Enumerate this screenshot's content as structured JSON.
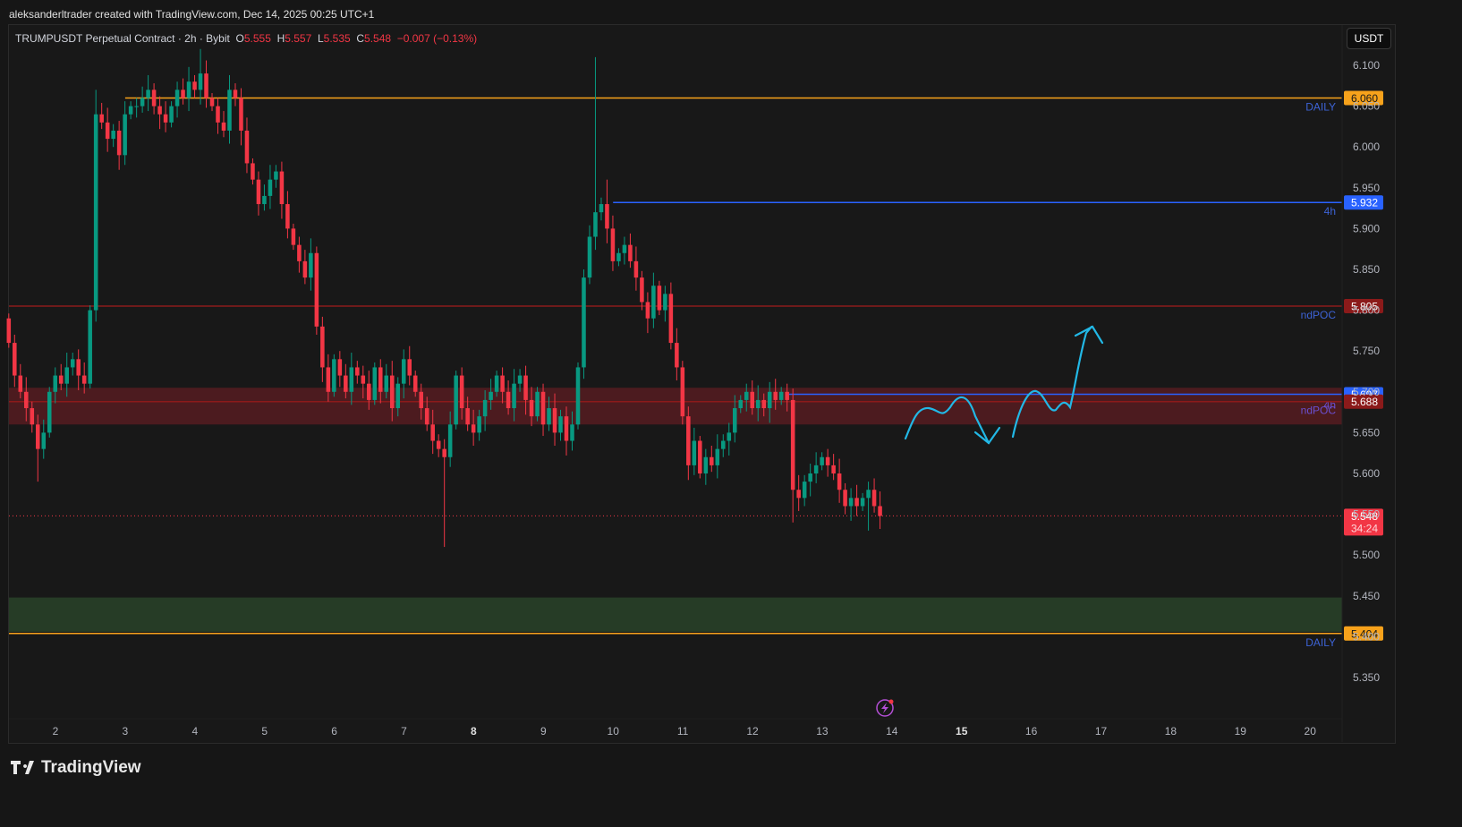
{
  "credit": "aleksanderltrader created with TradingView.com, Dec 14, 2025 00:25 UTC+1",
  "legend": {
    "symbol": "TRUMPUSDT Perpetual Contract · 2h · Bybit",
    "o_label": "O",
    "o": "5.555",
    "h_label": "H",
    "h": "5.557",
    "l_label": "L",
    "l": "5.535",
    "c_label": "C",
    "c": "5.548",
    "change": "−0.007 (−0.13%)"
  },
  "currency_button": "USDT",
  "logo_text": "TradingView",
  "colors": {
    "up": "#089981",
    "down": "#f23645",
    "daily": "#f7a21b",
    "blue": "#2962ff",
    "poc": "#8b1a1a",
    "cyan": "#22b8e6"
  },
  "chart_data": {
    "type": "candlestick",
    "title": "TRUMPUSDT Perpetual Contract · 2h · Bybit",
    "ylim": [
      5.3,
      6.15
    ],
    "y_ticks": [
      "6.100",
      "6.050",
      "6.000",
      "5.950",
      "5.900",
      "5.850",
      "5.800",
      "5.750",
      "5.700",
      "5.650",
      "5.600",
      "5.550",
      "5.500",
      "5.450",
      "5.400",
      "5.350"
    ],
    "y_tick_values": [
      6.1,
      6.05,
      6.0,
      5.95,
      5.9,
      5.85,
      5.8,
      5.75,
      5.7,
      5.65,
      5.6,
      5.55,
      5.5,
      5.45,
      5.4,
      5.35
    ],
    "x_ticks": [
      {
        "label": "2",
        "day": 2
      },
      {
        "label": "3",
        "day": 3
      },
      {
        "label": "4",
        "day": 4
      },
      {
        "label": "5",
        "day": 5
      },
      {
        "label": "6",
        "day": 6
      },
      {
        "label": "7",
        "day": 7
      },
      {
        "label": "8",
        "day": 8,
        "bold": true
      },
      {
        "label": "9",
        "day": 9
      },
      {
        "label": "10",
        "day": 10
      },
      {
        "label": "11",
        "day": 11
      },
      {
        "label": "12",
        "day": 12
      },
      {
        "label": "13",
        "day": 13
      },
      {
        "label": "14",
        "day": 14
      },
      {
        "label": "15",
        "day": 15,
        "bold": true
      },
      {
        "label": "16",
        "day": 16
      },
      {
        "label": "17",
        "day": 17
      },
      {
        "label": "18",
        "day": 18
      },
      {
        "label": "19",
        "day": 19
      },
      {
        "label": "20",
        "day": 20
      }
    ],
    "first_candle_day": 1.33,
    "candles_per_day": 12,
    "open0": 5.79,
    "closes": [
      5.76,
      5.72,
      5.7,
      5.68,
      5.66,
      5.63,
      5.65,
      5.7,
      5.72,
      5.71,
      5.73,
      5.74,
      5.72,
      5.71,
      5.8,
      6.04,
      6.03,
      6.01,
      6.02,
      5.99,
      6.04,
      6.05,
      6.05,
      6.06,
      6.07,
      6.05,
      6.04,
      6.03,
      6.05,
      6.07,
      6.06,
      6.08,
      6.07,
      6.09,
      6.06,
      6.05,
      6.03,
      6.02,
      6.07,
      6.06,
      6.02,
      5.98,
      5.96,
      5.93,
      5.94,
      5.96,
      5.97,
      5.93,
      5.9,
      5.88,
      5.86,
      5.84,
      5.87,
      5.78,
      5.73,
      5.7,
      5.74,
      5.72,
      5.7,
      5.73,
      5.72,
      5.71,
      5.69,
      5.73,
      5.7,
      5.72,
      5.68,
      5.71,
      5.74,
      5.72,
      5.7,
      5.68,
      5.66,
      5.64,
      5.63,
      5.62,
      5.66,
      5.72,
      5.68,
      5.66,
      5.65,
      5.67,
      5.69,
      5.7,
      5.72,
      5.7,
      5.68,
      5.71,
      5.72,
      5.69,
      5.67,
      5.7,
      5.66,
      5.68,
      5.65,
      5.67,
      5.64,
      5.66,
      5.73,
      5.84,
      5.89,
      5.92,
      5.93,
      5.9,
      5.86,
      5.87,
      5.88,
      5.86,
      5.84,
      5.81,
      5.79,
      5.83,
      5.8,
      5.82,
      5.76,
      5.73,
      5.67,
      5.61,
      5.64,
      5.6,
      5.62,
      5.61,
      5.63,
      5.64,
      5.65,
      5.68,
      5.69,
      5.7,
      5.68,
      5.69,
      5.68,
      5.7,
      5.69,
      5.7,
      5.69,
      5.58,
      5.57,
      5.59,
      5.6,
      5.61,
      5.62,
      5.61,
      5.6,
      5.58,
      5.56,
      5.57,
      5.56,
      5.57,
      5.58,
      5.56,
      5.548
    ],
    "wick_overrides": [
      {
        "i": 5,
        "l": 5.59
      },
      {
        "i": 15,
        "h": 6.07
      },
      {
        "i": 33,
        "h": 6.12
      },
      {
        "i": 75,
        "l": 5.51
      },
      {
        "i": 101,
        "h": 6.11
      },
      {
        "i": 103,
        "h": 5.96
      },
      {
        "i": 135,
        "l": 5.54
      },
      {
        "i": 148,
        "l": 5.53
      }
    ],
    "levels": [
      {
        "price": 6.06,
        "label": "6.060",
        "tag": "DAILY",
        "color": "#f7a21b",
        "text": "#1a1a1a",
        "start_day": 3.0
      },
      {
        "price": 5.932,
        "label": "5.932",
        "tag": "4h",
        "color": "#2962ff",
        "text": "#ffffff",
        "start_day": 10.0
      },
      {
        "price": 5.805,
        "label": "5.805",
        "tag": "ndPOC",
        "color": "#8b1a1a",
        "text": "#ffffff",
        "start_day": 1.2
      },
      {
        "price": 5.697,
        "label": "5.697",
        "tag": "4h",
        "color": "#2962ff",
        "text": "#ffffff",
        "start_day": 12.5
      },
      {
        "price": 5.688,
        "label": "5.688",
        "tag": "ndPOC",
        "color": "#8b1a1a",
        "text": "#ffffff",
        "start_day": 1.2
      },
      {
        "price": 5.404,
        "label": "5.404",
        "tag": "DAILY",
        "color": "#f7a21b",
        "text": "#1a1a1a",
        "start_day": 1.2
      }
    ],
    "zones": [
      {
        "top": 5.705,
        "bottom": 5.66,
        "color": "rgba(140,30,40,0.45)"
      },
      {
        "top": 5.448,
        "bottom": 5.406,
        "color": "rgba(46,80,46,0.65)"
      }
    ],
    "last_price": {
      "label": "5.548",
      "value": 5.548,
      "countdown": "34:24"
    }
  }
}
